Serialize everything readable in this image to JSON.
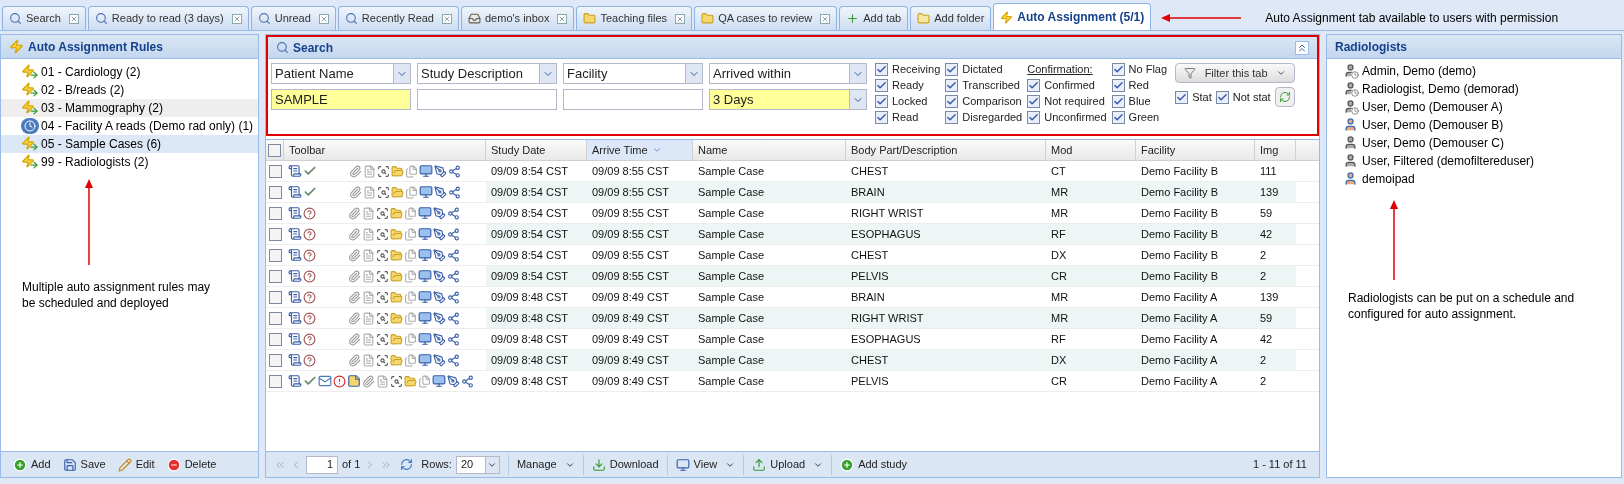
{
  "tabs": [
    {
      "label": "Search",
      "kind": "search",
      "closable": true,
      "selected": false
    },
    {
      "label": "Ready to read (3 days)",
      "kind": "search",
      "closable": true,
      "selected": false
    },
    {
      "label": "Unread",
      "kind": "search",
      "closable": true,
      "selected": false
    },
    {
      "label": "Recently Read",
      "kind": "search",
      "closable": true,
      "selected": false
    },
    {
      "label": "demo's inbox",
      "kind": "inbox",
      "closable": true,
      "selected": false
    },
    {
      "label": "Teaching files",
      "kind": "folder",
      "closable": true,
      "selected": false
    },
    {
      "label": "QA cases to review",
      "kind": "folder",
      "closable": true,
      "selected": false
    },
    {
      "label": "Add tab",
      "kind": "add",
      "closable": false,
      "selected": false
    },
    {
      "label": "Add folder",
      "kind": "add-folder",
      "closable": false,
      "selected": false
    },
    {
      "label": "Auto Assignment (5/1)",
      "kind": "lightning",
      "closable": false,
      "selected": true
    }
  ],
  "tab_annotation": "Auto Assignment tab available to users with permission",
  "rules_panel": {
    "title": "Auto Assignment Rules",
    "rules": [
      {
        "label": "01 - Cardiology (2)",
        "kind": "rule",
        "selected": false,
        "hovered": false
      },
      {
        "label": "02 - B/reads (2)",
        "kind": "rule",
        "selected": false,
        "hovered": false
      },
      {
        "label": "03 - Mammography (2)",
        "kind": "rule",
        "selected": false,
        "hovered": true
      },
      {
        "label": "04 - Facility A reads (Demo rad only) (1)",
        "kind": "scheduled",
        "selected": false,
        "hovered": false
      },
      {
        "label": "05 - Sample Cases (6)",
        "kind": "rule",
        "selected": true,
        "hovered": false
      },
      {
        "label": "99 - Radiologists (2)",
        "kind": "rule",
        "selected": false,
        "hovered": false
      }
    ],
    "annotation": "Multiple auto assignment rules may be scheduled and deployed",
    "buttons": [
      {
        "label": "Add",
        "kind": "add"
      },
      {
        "label": "Save",
        "kind": "save"
      },
      {
        "label": "Edit",
        "kind": "edit"
      },
      {
        "label": "Delete",
        "kind": "delete"
      }
    ]
  },
  "search": {
    "title": "Search",
    "outlined": true,
    "filters": [
      {
        "field": "Patient Name",
        "value": "SAMPLE",
        "kind": "text"
      },
      {
        "field": "Study Description",
        "kind": "text"
      },
      {
        "field": "Facility",
        "kind": "text"
      },
      {
        "field": "Arrived within",
        "value": "3 Days",
        "kind": "dropdown"
      }
    ],
    "status_checks": [
      {
        "items": [
          {
            "label": "Receiving",
            "checked": true
          },
          {
            "label": "Ready",
            "checked": true
          },
          {
            "label": "Locked",
            "checked": true
          },
          {
            "label": "Read",
            "checked": true
          }
        ]
      },
      {
        "items": [
          {
            "label": "Dictated",
            "checked": true
          },
          {
            "label": "Transcribed",
            "checked": true
          },
          {
            "label": "Comparison",
            "checked": true
          },
          {
            "label": "Disregarded",
            "checked": true
          }
        ]
      },
      {
        "heading": "Confirmation:",
        "items": [
          {
            "label": "Confirmed",
            "checked": true
          },
          {
            "label": "Not required",
            "checked": true
          },
          {
            "label": "Unconfirmed",
            "checked": true
          }
        ]
      },
      {
        "items": [
          {
            "label": "No Flag",
            "checked": true
          },
          {
            "label": "Red",
            "checked": true
          },
          {
            "label": "Blue",
            "checked": true
          },
          {
            "label": "Green",
            "checked": true
          }
        ]
      }
    ],
    "filter_button": "Filter this tab",
    "stat_checks": [
      {
        "label": "Stat",
        "checked": true
      },
      {
        "label": "Not stat",
        "checked": true
      }
    ]
  },
  "table": {
    "all_checked": false,
    "columns": [
      {
        "label": "Toolbar",
        "sorted": false
      },
      {
        "label": "Study Date",
        "sorted": false
      },
      {
        "label": "Arrive Time",
        "sorted": true
      },
      {
        "label": "Name",
        "sorted": false
      },
      {
        "label": "Body Part/Description",
        "sorted": false
      },
      {
        "label": "Mod",
        "sorted": false
      },
      {
        "label": "Facility",
        "sorted": false
      },
      {
        "label": "Img",
        "sorted": false
      }
    ],
    "rows": [
      {
        "checked": false,
        "kind": "confirmed",
        "flagged": false,
        "cells": [
          "",
          "09/09 8:54 CST",
          "09/09 8:55 CST",
          "Sample Case",
          "CHEST",
          "CT",
          "Demo Facility B",
          "111"
        ]
      },
      {
        "checked": false,
        "kind": "confirmed",
        "flagged": false,
        "cells": [
          "",
          "09/09 8:54 CST",
          "09/09 8:55 CST",
          "Sample Case",
          "BRAIN",
          "MR",
          "Demo Facility B",
          "139"
        ]
      },
      {
        "checked": false,
        "kind": "unconfirmed",
        "flagged": false,
        "cells": [
          "",
          "09/09 8:54 CST",
          "09/09 8:55 CST",
          "Sample Case",
          "RIGHT WRIST",
          "MR",
          "Demo Facility B",
          "59"
        ]
      },
      {
        "checked": false,
        "kind": "unconfirmed",
        "flagged": false,
        "cells": [
          "",
          "09/09 8:54 CST",
          "09/09 8:55 CST",
          "Sample Case",
          "ESOPHAGUS",
          "RF",
          "Demo Facility B",
          "42"
        ]
      },
      {
        "checked": false,
        "kind": "unconfirmed",
        "flagged": false,
        "cells": [
          "",
          "09/09 8:54 CST",
          "09/09 8:55 CST",
          "Sample Case",
          "CHEST",
          "DX",
          "Demo Facility B",
          "2"
        ]
      },
      {
        "checked": false,
        "kind": "unconfirmed",
        "flagged": false,
        "cells": [
          "",
          "09/09 8:54 CST",
          "09/09 8:55 CST",
          "Sample Case",
          "PELVIS",
          "CR",
          "Demo Facility B",
          "2"
        ]
      },
      {
        "checked": false,
        "kind": "unconfirmed",
        "flagged": false,
        "cells": [
          "",
          "09/09 8:48 CST",
          "09/09 8:49 CST",
          "Sample Case",
          "BRAIN",
          "MR",
          "Demo Facility A",
          "139"
        ]
      },
      {
        "checked": false,
        "kind": "unconfirmed",
        "flagged": false,
        "cells": [
          "",
          "09/09 8:48 CST",
          "09/09 8:49 CST",
          "Sample Case",
          "RIGHT WRIST",
          "MR",
          "Demo Facility A",
          "59"
        ]
      },
      {
        "checked": false,
        "kind": "unconfirmed",
        "flagged": false,
        "cells": [
          "",
          "09/09 8:48 CST",
          "09/09 8:49 CST",
          "Sample Case",
          "ESOPHAGUS",
          "RF",
          "Demo Facility A",
          "42"
        ]
      },
      {
        "checked": false,
        "kind": "unconfirmed",
        "flagged": false,
        "cells": [
          "",
          "09/09 8:48 CST",
          "09/09 8:49 CST",
          "Sample Case",
          "CHEST",
          "DX",
          "Demo Facility A",
          "2"
        ]
      },
      {
        "checked": false,
        "kind": "confirmed",
        "flagged": true,
        "cells": [
          "",
          "09/09 8:48 CST",
          "09/09 8:49 CST",
          "Sample Case",
          "PELVIS",
          "CR",
          "Demo Facility A",
          "2"
        ]
      }
    ]
  },
  "pager": {
    "page": "1",
    "of": "of 1",
    "rows_label": "Rows:",
    "rows": "20",
    "actions": [
      {
        "label": "Manage",
        "kind": "menu"
      },
      {
        "label": "Download",
        "kind": "download"
      },
      {
        "label": "View",
        "kind": "view"
      },
      {
        "label": "Upload",
        "kind": "upload"
      },
      {
        "label": "Add study",
        "kind": "add"
      }
    ],
    "summary": "1 - 11 of 11"
  },
  "radiologists_panel": {
    "title": "Radiologists",
    "users": [
      {
        "name": "Admin, Demo (demo)",
        "kind": "scheduled"
      },
      {
        "name": "Radiologist, Demo (demorad)",
        "kind": "scheduled"
      },
      {
        "name": "User, Demo (Demouser A)",
        "kind": "scheduled"
      },
      {
        "name": "User, Demo (Demouser B)",
        "kind": "active"
      },
      {
        "name": "User, Demo (Demouser C)",
        "kind": "inactive"
      },
      {
        "name": "User, Filtered (demofiltereduser)",
        "kind": "inactive"
      },
      {
        "name": "demoipad",
        "kind": "active"
      }
    ],
    "annotation": "Radiologists can be put on a schedule and configured for auto assignment."
  }
}
